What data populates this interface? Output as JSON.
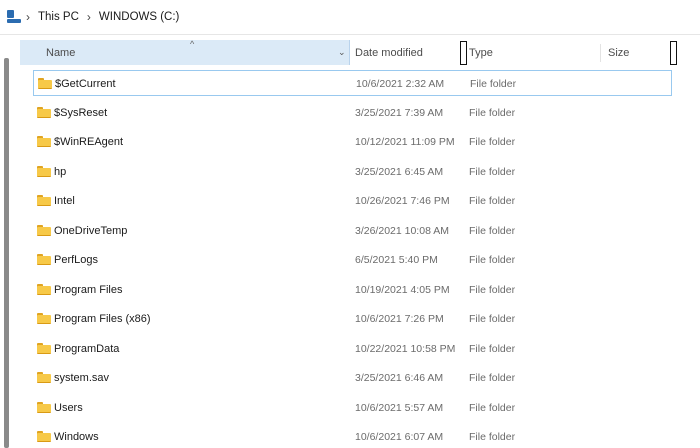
{
  "breadcrumb": {
    "icon": "this-pc-icon",
    "items": [
      "This PC",
      "WINDOWS (C:)"
    ],
    "separator": "›"
  },
  "columns": {
    "name": "Name",
    "date": "Date modified",
    "type": "Type",
    "size": "Size",
    "sort_indicator": "^",
    "dropdown": "⌄"
  },
  "colors": {
    "header_active_bg": "#dbeaf7",
    "selected_border": "#99c9ef",
    "folder_yellow": "#f7c948"
  },
  "rows": [
    {
      "name": "$GetCurrent",
      "date": "10/6/2021 2:32 AM",
      "type": "File folder",
      "size": "",
      "selected": true
    },
    {
      "name": "$SysReset",
      "date": "3/25/2021 7:39 AM",
      "type": "File folder",
      "size": ""
    },
    {
      "name": "$WinREAgent",
      "date": "10/12/2021 11:09 PM",
      "type": "File folder",
      "size": ""
    },
    {
      "name": "hp",
      "date": "3/25/2021 6:45 AM",
      "type": "File folder",
      "size": ""
    },
    {
      "name": "Intel",
      "date": "10/26/2021 7:46 PM",
      "type": "File folder",
      "size": ""
    },
    {
      "name": "OneDriveTemp",
      "date": "3/26/2021 10:08 AM",
      "type": "File folder",
      "size": ""
    },
    {
      "name": "PerfLogs",
      "date": "6/5/2021 5:40 PM",
      "type": "File folder",
      "size": ""
    },
    {
      "name": "Program Files",
      "date": "10/19/2021 4:05 PM",
      "type": "File folder",
      "size": ""
    },
    {
      "name": "Program Files (x86)",
      "date": "10/6/2021 7:26 PM",
      "type": "File folder",
      "size": ""
    },
    {
      "name": "ProgramData",
      "date": "10/22/2021 10:58 PM",
      "type": "File folder",
      "size": ""
    },
    {
      "name": "system.sav",
      "date": "3/25/2021 6:46 AM",
      "type": "File folder",
      "size": ""
    },
    {
      "name": "Users",
      "date": "10/6/2021 5:57 AM",
      "type": "File folder",
      "size": ""
    },
    {
      "name": "Windows",
      "date": "10/6/2021 6:07 AM",
      "type": "File folder",
      "size": ""
    }
  ]
}
